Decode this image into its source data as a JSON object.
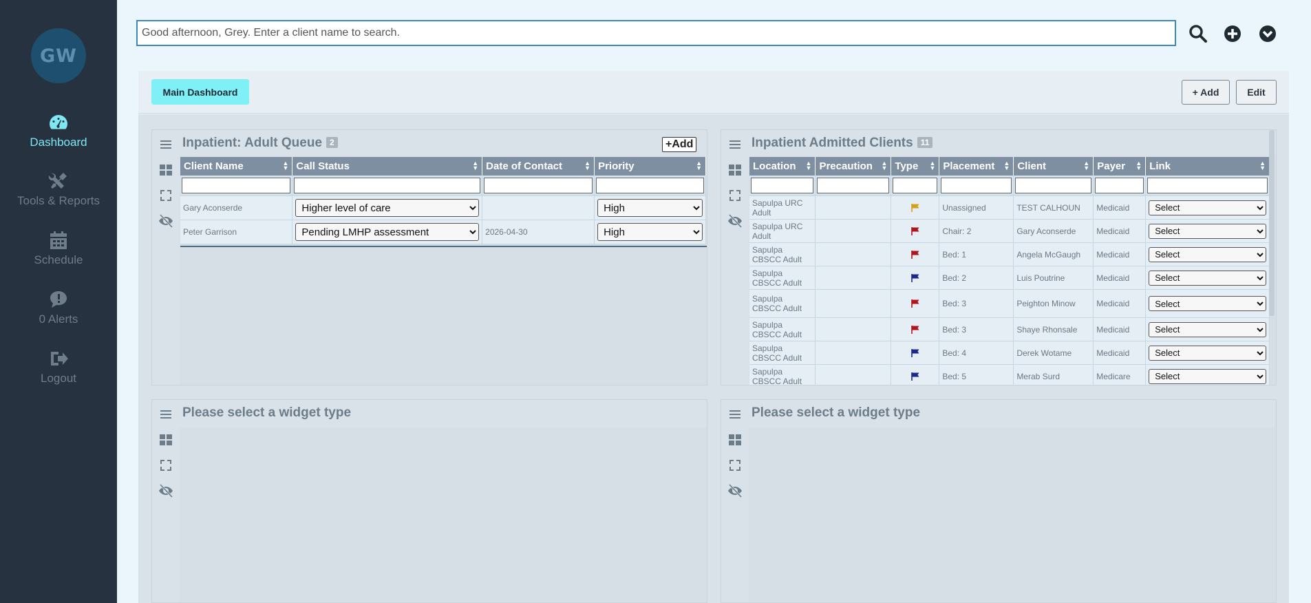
{
  "sidebar": {
    "avatar": "GW",
    "items": [
      {
        "label": "Dashboard",
        "icon": "dashboard-gauge-icon"
      },
      {
        "label": "Tools & Reports",
        "icon": "tools-icon"
      },
      {
        "label": "Schedule",
        "icon": "calendar-icon"
      },
      {
        "label": "0 Alerts",
        "icon": "alert-chat-icon"
      },
      {
        "label": "Logout",
        "icon": "logout-icon"
      }
    ]
  },
  "search": {
    "placeholder": "Good afternoon, Grey. Enter a client name to search."
  },
  "header": {
    "main_dashboard": "Main Dashboard",
    "add": "+ Add",
    "edit": "Edit"
  },
  "queue": {
    "title": "Inpatient: Adult Queue",
    "count": "2",
    "add_label": "+Add",
    "columns": [
      "Client Name",
      "Call Status",
      "Date of Contact",
      "Priority"
    ],
    "rows": [
      {
        "client": "Gary Aconserde",
        "status": "Higher level of care",
        "date": "",
        "priority": "High"
      },
      {
        "client": "Peter Garrison",
        "status": "Pending LMHP assessment",
        "date": "2026-04-30",
        "priority": "High"
      }
    ]
  },
  "admitted": {
    "title": "Inpatient Admitted Clients",
    "count": "11",
    "columns": [
      "Location",
      "Precaution",
      "Type",
      "Placement",
      "Client",
      "Payer",
      "Link"
    ],
    "rows": [
      {
        "location": "Sapulpa URC Adult",
        "flag": "orange",
        "placement": "Unassigned",
        "client": "TEST CALHOUN",
        "payer": "Medicaid",
        "link": "Select"
      },
      {
        "location": "Sapulpa URC Adult",
        "flag": "red",
        "placement": "Chair: 2",
        "client": "Gary Aconserde",
        "payer": "Medicaid",
        "link": "Select"
      },
      {
        "location": "Sapulpa CBSCC Adult",
        "flag": "red",
        "placement": "Bed: 1",
        "client": "Angela McGaugh",
        "payer": "Medicaid",
        "link": "Select"
      },
      {
        "location": "Sapulpa CBSCC Adult",
        "flag": "blue",
        "placement": "Bed: 2",
        "client": "Luis Poutrine",
        "payer": "Medicaid",
        "link": "Select"
      },
      {
        "location": "Sapulpa CBSCC Adult",
        "flag": "red",
        "placement": "Bed: 3",
        "client": "Peighton Minow",
        "payer": "Medicaid",
        "link": "Select"
      },
      {
        "location": "Sapulpa CBSCC Adult",
        "flag": "red",
        "placement": "Bed: 3",
        "client": "Shaye Rhonsale",
        "payer": "Medicaid",
        "link": "Select"
      },
      {
        "location": "Sapulpa CBSCC Adult",
        "flag": "blue",
        "placement": "Bed: 4",
        "client": "Derek Wotame",
        "payer": "Medicaid",
        "link": "Select"
      },
      {
        "location": "Sapulpa CBSCC Adult",
        "flag": "blue",
        "placement": "Bed: 5",
        "client": "Merab Surd",
        "payer": "Medicare",
        "link": "Select"
      }
    ]
  },
  "empty_widgets": [
    "Please select a widget type",
    "Please select a widget type"
  ],
  "colors": {
    "flag_orange": "#d4a017",
    "flag_red": "#b0141c",
    "flag_blue": "#1a2a8c",
    "accent": "#7ff0f5"
  }
}
